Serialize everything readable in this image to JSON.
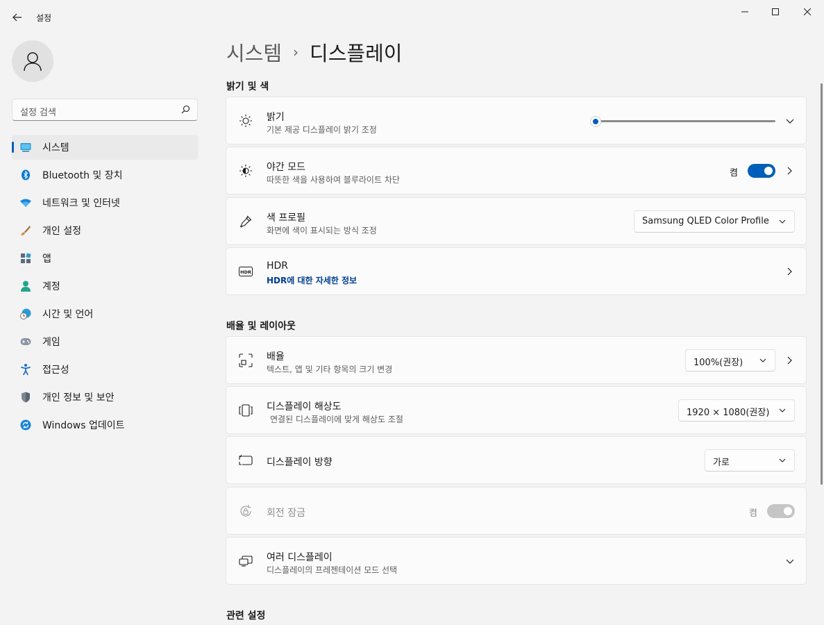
{
  "window": {
    "title": "설정"
  },
  "search": {
    "placeholder": "설정 검색"
  },
  "sidebar": {
    "items": [
      {
        "label": "시스템",
        "icon": "system-icon",
        "active": true
      },
      {
        "label": "Bluetooth 및 장치",
        "icon": "bluetooth-icon"
      },
      {
        "label": "네트워크 및 인터넷",
        "icon": "wifi-icon"
      },
      {
        "label": "개인 설정",
        "icon": "brush-icon"
      },
      {
        "label": "앱",
        "icon": "apps-icon"
      },
      {
        "label": "계정",
        "icon": "account-icon"
      },
      {
        "label": "시간 및 언어",
        "icon": "globe-clock-icon"
      },
      {
        "label": "게임",
        "icon": "gamepad-icon"
      },
      {
        "label": "접근성",
        "icon": "accessibility-icon"
      },
      {
        "label": "개인 정보 및 보안",
        "icon": "shield-icon"
      },
      {
        "label": "Windows 업데이트",
        "icon": "update-icon"
      }
    ]
  },
  "breadcrumb": {
    "parent": "시스템",
    "separator": "›",
    "current": "디스플레이"
  },
  "sections": {
    "brightness_color": "밝기 및 색",
    "scale_layout": "배율 및 레이아웃",
    "related": "관련 설정"
  },
  "cards": {
    "brightness": {
      "title": "밝기",
      "subtitle": "기본 제공 디스플레이 밝기 조정",
      "value": 0
    },
    "night_light": {
      "title": "야간 모드",
      "subtitle": "따뜻한 색을 사용하여 블루라이트 차단",
      "state_label": "켬",
      "on": true
    },
    "color_profile": {
      "title": "색 프로필",
      "subtitle": "화면에 색이 표시되는 방식 조정",
      "selected": "Samsung QLED Color Profile"
    },
    "hdr": {
      "title": "HDR",
      "link": "HDR에 대한 자세한 정보"
    },
    "scale": {
      "title": "배율",
      "subtitle": "텍스트, 앱 및 기타 항목의 크기 변경",
      "selected": "100%(권장)"
    },
    "resolution": {
      "title": "디스플레이 해상도",
      "subtitle": "연결된 디스플레이에 맞게 해상도 조절",
      "selected": "1920 × 1080(권장)"
    },
    "orientation": {
      "title": "디스플레이 방향",
      "selected": "가로"
    },
    "rotation_lock": {
      "title": "회전 잠금",
      "state_label": "켬",
      "on": true,
      "disabled": true
    },
    "multiple_displays": {
      "title": "여러 디스플레이",
      "subtitle": "디스플레이의 프레젠테이션 모드 선택"
    }
  },
  "colors": {
    "accent": "#005fb8",
    "background": "#f3f3f3",
    "card": "#fbfbfb",
    "link": "#003e92"
  }
}
